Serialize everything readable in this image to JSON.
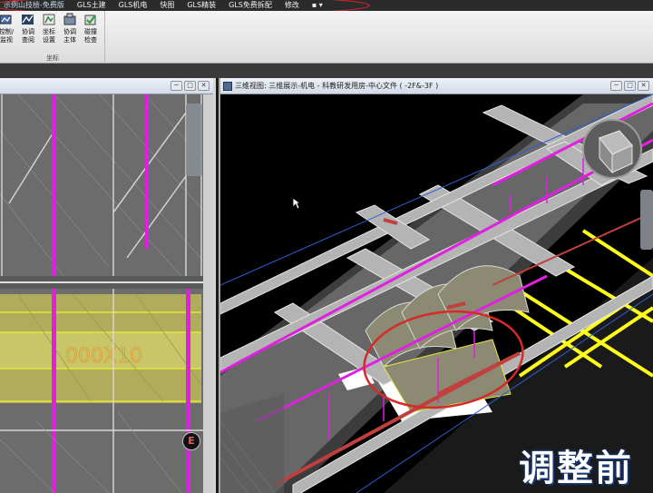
{
  "menubar": {
    "items": [
      "示例山技檢-免费版",
      "GLS土建",
      "GLS机电",
      "快图",
      "GLS精装",
      "GLS免费拆配",
      "修改",
      "▪ ▾"
    ]
  },
  "ribbon": {
    "buttons": [
      {
        "label": "控制/\n监视",
        "icon": "monitor-icon"
      },
      {
        "label": "协调\n查阅",
        "icon": "coordinate-review-icon"
      },
      {
        "label": "坐标\n设置",
        "icon": "coordinate-settings-icon"
      },
      {
        "label": "协调\n主体",
        "icon": "coordinate-host-icon"
      },
      {
        "label": "碰撞\n检查",
        "icon": "collision-check-icon"
      }
    ],
    "group_label": "坐标"
  },
  "left_view": {
    "window_buttons": [
      "─",
      "□",
      "✕"
    ],
    "elevation_marker": "E",
    "annotation_text": "000X10"
  },
  "main_view": {
    "title": "三维视图: 三维展示-机电 - 科教研发用房-中心文件 ( -2F&-3F )",
    "window_buttons": [
      "─",
      "□",
      "✕"
    ]
  },
  "caption": "调整前",
  "colors": {
    "accent_highlight": "#d4252a",
    "pipe_magenta": "#e020e0",
    "zone_yellow": "#e6e63c",
    "beam_gray": "#c8c8c8"
  }
}
